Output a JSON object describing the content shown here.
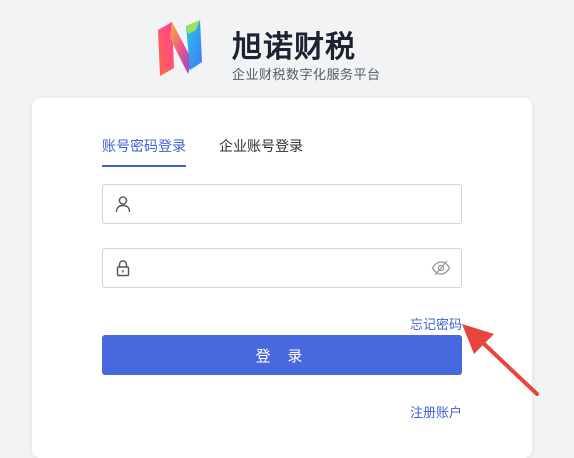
{
  "brand": {
    "name": "旭诺财税",
    "subtitle": "企业财税数字化服务平台"
  },
  "tabs": [
    {
      "label": "账号密码登录",
      "active": true
    },
    {
      "label": "企业账号登录",
      "active": false
    }
  ],
  "username_field": {
    "value": "",
    "placeholder": "",
    "icon": "user-icon"
  },
  "password_field": {
    "value": "",
    "placeholder": "",
    "icon": "lock-icon",
    "toggle_icon": "eye-off-icon"
  },
  "forgot_password": "忘记密码",
  "login_button": "登 录",
  "register_link": "注册账户",
  "colors": {
    "accent": "#3f5fd6",
    "button": "#4869dd",
    "annotation_arrow": "#e8453c"
  }
}
